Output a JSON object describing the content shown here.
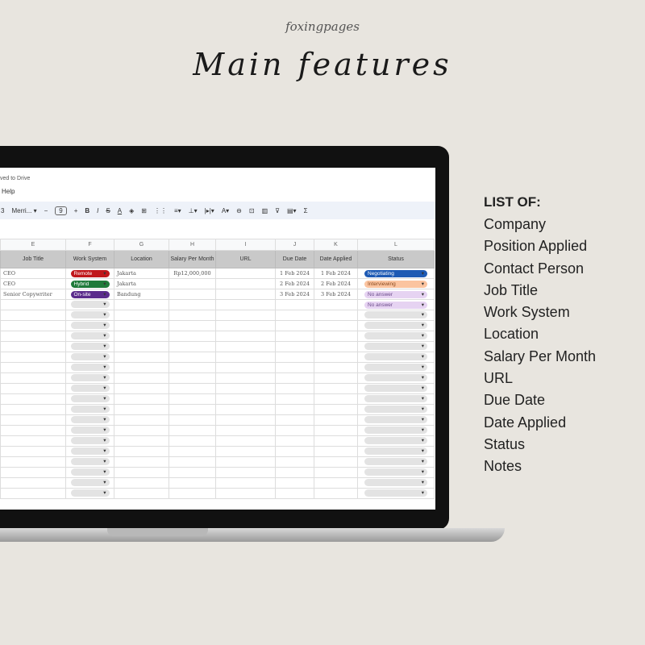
{
  "brand": "foxingpages",
  "title": "Main features",
  "app": {
    "saved": "ved to Drive",
    "menu_help": "Help",
    "toolbar": {
      "zoom_partial": "3",
      "font": "Merri...",
      "font_size": "9"
    }
  },
  "sheet": {
    "columns": [
      "E",
      "F",
      "G",
      "H",
      "I",
      "J",
      "K",
      "L"
    ],
    "headers": [
      "Job Title",
      "Work System",
      "Location",
      "Salary Per Month",
      "URL",
      "Due Date",
      "Date Applied",
      "Status"
    ],
    "rows": [
      {
        "job": "CEO",
        "work": "Remote",
        "work_color": "#c0171b",
        "loc": "Jakarta",
        "salary": "Rp12,000,000",
        "due": "1 Feb 2024",
        "applied": "1 Feb 2024",
        "status": "Negotiating",
        "status_bg": "#1e5ab4",
        "status_fg": "#ffffff"
      },
      {
        "job": "CEO",
        "work": "Hybrid",
        "work_color": "#1f7a3a",
        "loc": "Jakarta",
        "salary": "",
        "due": "2 Feb 2024",
        "applied": "2 Feb 2024",
        "status": "Interviewing",
        "status_bg": "#fbc4a0",
        "status_fg": "#8a4a20"
      },
      {
        "job": "Senior Copywriter",
        "work": "On-site",
        "work_color": "#5b2c8c",
        "loc": "Bandung",
        "salary": "",
        "due": "3 Feb 2024",
        "applied": "3 Feb 2024",
        "status": "No answer",
        "status_bg": "#e6d3f2",
        "status_fg": "#6a4a8a"
      },
      {
        "job": "",
        "work": "",
        "loc": "",
        "salary": "",
        "due": "",
        "applied": "",
        "status": "No answer",
        "status_bg": "#e6d3f2",
        "status_fg": "#6a4a8a"
      }
    ]
  },
  "list": {
    "heading": "LIST OF:",
    "items": [
      "Company",
      "Position Applied",
      "Contact Person",
      "Job Title",
      "Work System",
      "Location",
      "Salary Per Month",
      "URL",
      "Due Date",
      "Date Applied",
      "Status",
      "Notes"
    ]
  }
}
